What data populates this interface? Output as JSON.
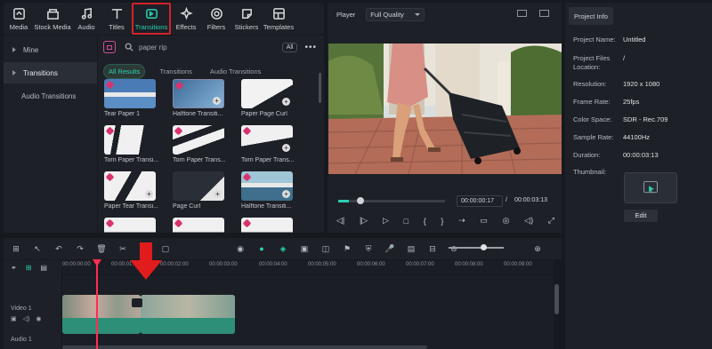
{
  "toolbar": {
    "items": [
      {
        "label": "Media",
        "icon": "media-icon"
      },
      {
        "label": "Stock Media",
        "icon": "stock-media-icon"
      },
      {
        "label": "Audio",
        "icon": "audio-icon"
      },
      {
        "label": "Titles",
        "icon": "titles-icon"
      },
      {
        "label": "Transitions",
        "icon": "transitions-icon",
        "active": true
      },
      {
        "label": "Effects",
        "icon": "effects-icon"
      },
      {
        "label": "Filters",
        "icon": "filters-icon"
      },
      {
        "label": "Stickers",
        "icon": "stickers-icon"
      },
      {
        "label": "Templates",
        "icon": "templates-icon"
      }
    ]
  },
  "sidebar": {
    "items": [
      {
        "label": "Mine"
      },
      {
        "label": "Transitions"
      },
      {
        "label": "Audio Transitions"
      }
    ]
  },
  "library": {
    "search_value": "paper rip",
    "all_label": "All",
    "more_label": "•••",
    "filters": [
      "All Results",
      "Transitions",
      "Audio Transitions"
    ],
    "cards": [
      {
        "label": "Tear Paper 1"
      },
      {
        "label": "Halftone Transiti..."
      },
      {
        "label": "Paper Page Curl"
      },
      {
        "label": "Torn Paper Transi..."
      },
      {
        "label": "Torn Paper Trans..."
      },
      {
        "label": "Torn Paper Trans..."
      },
      {
        "label": "Paper Tear Transi..."
      },
      {
        "label": "Page Curl"
      },
      {
        "label": "Halftone Transiti..."
      },
      {
        "label": ""
      },
      {
        "label": ""
      },
      {
        "label": ""
      }
    ]
  },
  "player": {
    "label": "Player",
    "quality": "Full Quality",
    "progress": 0.1,
    "current_time": "00:00:00:17",
    "separator": "/",
    "total_time": "00:00:03:13",
    "controls": [
      "◁|",
      "|▷",
      "▷",
      "□",
      "{",
      "}",
      "⇢",
      "▭",
      "◎",
      "◁)",
      "⤢"
    ]
  },
  "project_info": {
    "tab": "Project Info",
    "rows": [
      {
        "label": "Project Name:",
        "value": "Untitled"
      },
      {
        "label": "Project Files Location:",
        "value": "/"
      },
      {
        "label": "Resolution:",
        "value": "1920 x 1080"
      },
      {
        "label": "Frame Rate:",
        "value": "25fps"
      },
      {
        "label": "Color Space:",
        "value": "SDR - Rec.709"
      },
      {
        "label": "Sample Rate:",
        "value": "44100Hz"
      },
      {
        "label": "Duration:",
        "value": "00:00:03:13"
      },
      {
        "label": "Thumbnail:",
        "value": ""
      }
    ],
    "edit_label": "Edit"
  },
  "timeline": {
    "tools": [
      "⊞",
      "↖",
      "↶",
      "↷",
      "🗑",
      "✂",
      "T",
      "▢",
      "◉",
      "●",
      "◈",
      "▣",
      "◫",
      "⚑",
      "⛨",
      "🎤",
      "▤",
      "⊟",
      "⊕",
      "⊖"
    ],
    "ruler": [
      "00:00:00:00",
      "00:00:01:00",
      "00:00:02:00",
      "00:00:03:00",
      "00:00:04:00",
      "00:00:05:00",
      "00:00:06:00",
      "00:00:07:00",
      "00:00:08:00",
      "00:00:09:00"
    ],
    "video_track_label": "Video 1",
    "audio_track_label": "Audio 1",
    "zoom_level": 0.62
  },
  "colors": {
    "accent": "#2bd0b0",
    "playhead": "#ff2d55",
    "highlight_box": "#d2232a",
    "arrow": "#e01c1c"
  }
}
